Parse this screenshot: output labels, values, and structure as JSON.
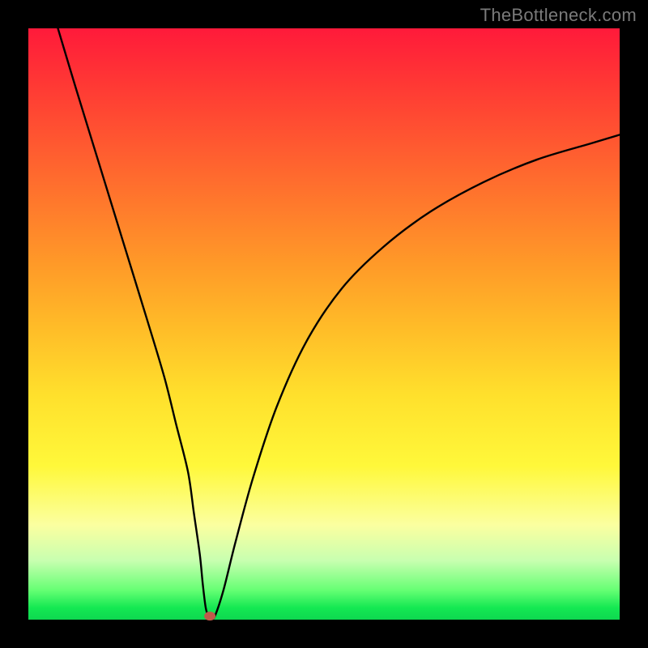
{
  "watermark": "TheBottleneck.com",
  "chart_data": {
    "type": "line",
    "title": "",
    "xlabel": "",
    "ylabel": "",
    "xlim": [
      0,
      100
    ],
    "ylim": [
      0,
      100
    ],
    "series": [
      {
        "name": "curve",
        "x": [
          5,
          8,
          12,
          16,
          20,
          23,
          25,
          27,
          28,
          29,
          29.5,
          30,
          30.5,
          31,
          31.5,
          33,
          35,
          38,
          42,
          47,
          53,
          60,
          68,
          77,
          86,
          95,
          100
        ],
        "y": [
          100,
          90,
          77,
          64,
          51,
          41,
          33,
          25,
          18,
          11,
          6,
          2,
          0.5,
          0.5,
          0.5,
          5,
          13,
          24,
          36,
          47,
          56,
          63,
          69,
          74,
          77.8,
          80.5,
          82
        ]
      }
    ],
    "marker": {
      "x": 30.7,
      "y": 0.6,
      "color": "#c05a4a"
    },
    "background": {
      "type": "vertical-gradient",
      "stops": [
        {
          "pos": 0,
          "color": "#ff1a3a"
        },
        {
          "pos": 50,
          "color": "#ffba28"
        },
        {
          "pos": 74,
          "color": "#fff83a"
        },
        {
          "pos": 95,
          "color": "#66ff74"
        },
        {
          "pos": 100,
          "color": "#0ed850"
        }
      ]
    }
  }
}
